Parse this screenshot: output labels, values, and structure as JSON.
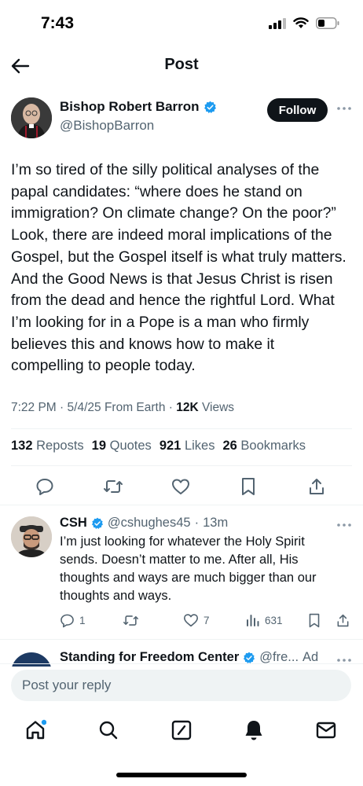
{
  "status_bar": {
    "time": "7:43"
  },
  "header": {
    "title": "Post"
  },
  "post": {
    "author_name": "Bishop Robert Barron",
    "author_handle": "@BishopBarron",
    "follow_label": "Follow",
    "body": "I’m so tired of the silly political analyses of the papal candidates: “where does he stand on immigration? On climate change? On the poor?” Look, there are indeed moral implications of the Gospel, but the Gospel itself is what truly matters. And the Good News is that Jesus Christ is risen from the dead and hence the rightful Lord. What I’m looking for in a Pope is a man who firmly believes this and knows how to make it compelling to people today.",
    "time": "7:22 PM",
    "date": "5/4/25",
    "source": "From Earth",
    "views_count": "12K",
    "views_label": "Views",
    "stats": {
      "reposts_count": "132",
      "reposts_label": "Reposts",
      "quotes_count": "19",
      "quotes_label": "Quotes",
      "likes_count": "921",
      "likes_label": "Likes",
      "bookmarks_count": "26",
      "bookmarks_label": "Bookmarks"
    }
  },
  "reply": {
    "name": "CSH",
    "handle": "@cshughes45",
    "time": "13m",
    "text": "I’m just looking for whatever the Holy Spirit sends. Doesn’t matter to me. After all, His thoughts and ways are much bigger than our thoughts and ways.",
    "replies_count": "1",
    "likes_count": "7",
    "views_count": "631"
  },
  "next_post": {
    "name": "Standing for Freedom Center",
    "handle": "@fre...",
    "ad_label": "Ad"
  },
  "composer": {
    "placeholder": "Post your reply"
  },
  "colors": {
    "verified": "#1d9bf0",
    "text": "#0f1419",
    "secondary": "#536471",
    "divider": "#eff3f4",
    "notification_dot": "#1d9bf0"
  }
}
